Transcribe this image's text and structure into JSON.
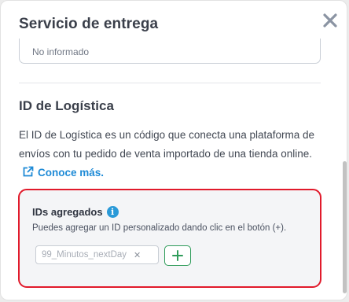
{
  "delivery_section": {
    "title": "Servicio de entrega",
    "field_value": "No informado"
  },
  "logistics_section": {
    "title": "ID de Logística",
    "description": "El ID de Logística es un código que conecta una plataforma de envíos con tu pedido de venta importado de una tienda online.",
    "learn_more_label": "Conoce más."
  },
  "ids_box": {
    "title": "IDs agregados",
    "info_symbol": "i",
    "hint": "Puedes agregar un ID personalizado dando clic en el botón (+).",
    "chips": [
      {
        "label": "99_Minutos_nextDay",
        "remove_symbol": "✕"
      }
    ]
  },
  "colors": {
    "accent_link": "#1e8ad6",
    "highlight_border": "#e11a2b",
    "add_button": "#2f9c5a",
    "info_icon": "#2a9ad8"
  },
  "icons": [
    "close-icon",
    "external-link-icon",
    "info-icon",
    "plus-icon",
    "chip-remove-icon"
  ]
}
